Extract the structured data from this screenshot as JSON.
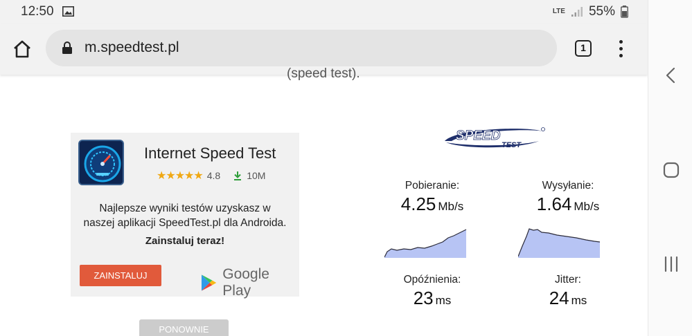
{
  "status_bar": {
    "time": "12:50",
    "network": "LTE",
    "battery": "55%"
  },
  "browser": {
    "url": "m.speedtest.pl",
    "tab_count": "1"
  },
  "page": {
    "partial_text": "(speed test).",
    "app_card": {
      "app_name": "Internet Speed Test",
      "rating": "4.8",
      "stars": "★★★★★",
      "downloads": "10M",
      "description_line1": "Najlepsze wyniki testów uzyskasz w",
      "description_line2": "naszej aplikacji SpeedTest.pl dla Androida.",
      "cta": "Zainstaluj teraz!",
      "install_label": "ZAINSTALUJ",
      "store_label": "Google Play"
    },
    "retry_label": "PONOWNIE",
    "results": {
      "download": {
        "label": "Pobieranie:",
        "value": "4.25",
        "unit": "Mb/s"
      },
      "upload": {
        "label": "Wysyłanie:",
        "value": "1.64",
        "unit": "Mb/s"
      },
      "ping": {
        "label": "Opóźnienia:",
        "value": "23",
        "unit": "ms"
      },
      "jitter": {
        "label": "Jitter:",
        "value": "24",
        "unit": "ms"
      }
    }
  },
  "colors": {
    "accent": "#e15a3b",
    "chart_fill": "#b7c4f4",
    "chart_stroke": "#2b2b3a",
    "logo_blue": "#1f2f6b"
  },
  "icons": {
    "home": "home-icon",
    "lock": "lock-icon",
    "tabs": "tabs-icon",
    "menu": "more-vert-icon",
    "back": "back-icon",
    "home_nav": "home-nav-icon",
    "recents": "recents-icon"
  }
}
